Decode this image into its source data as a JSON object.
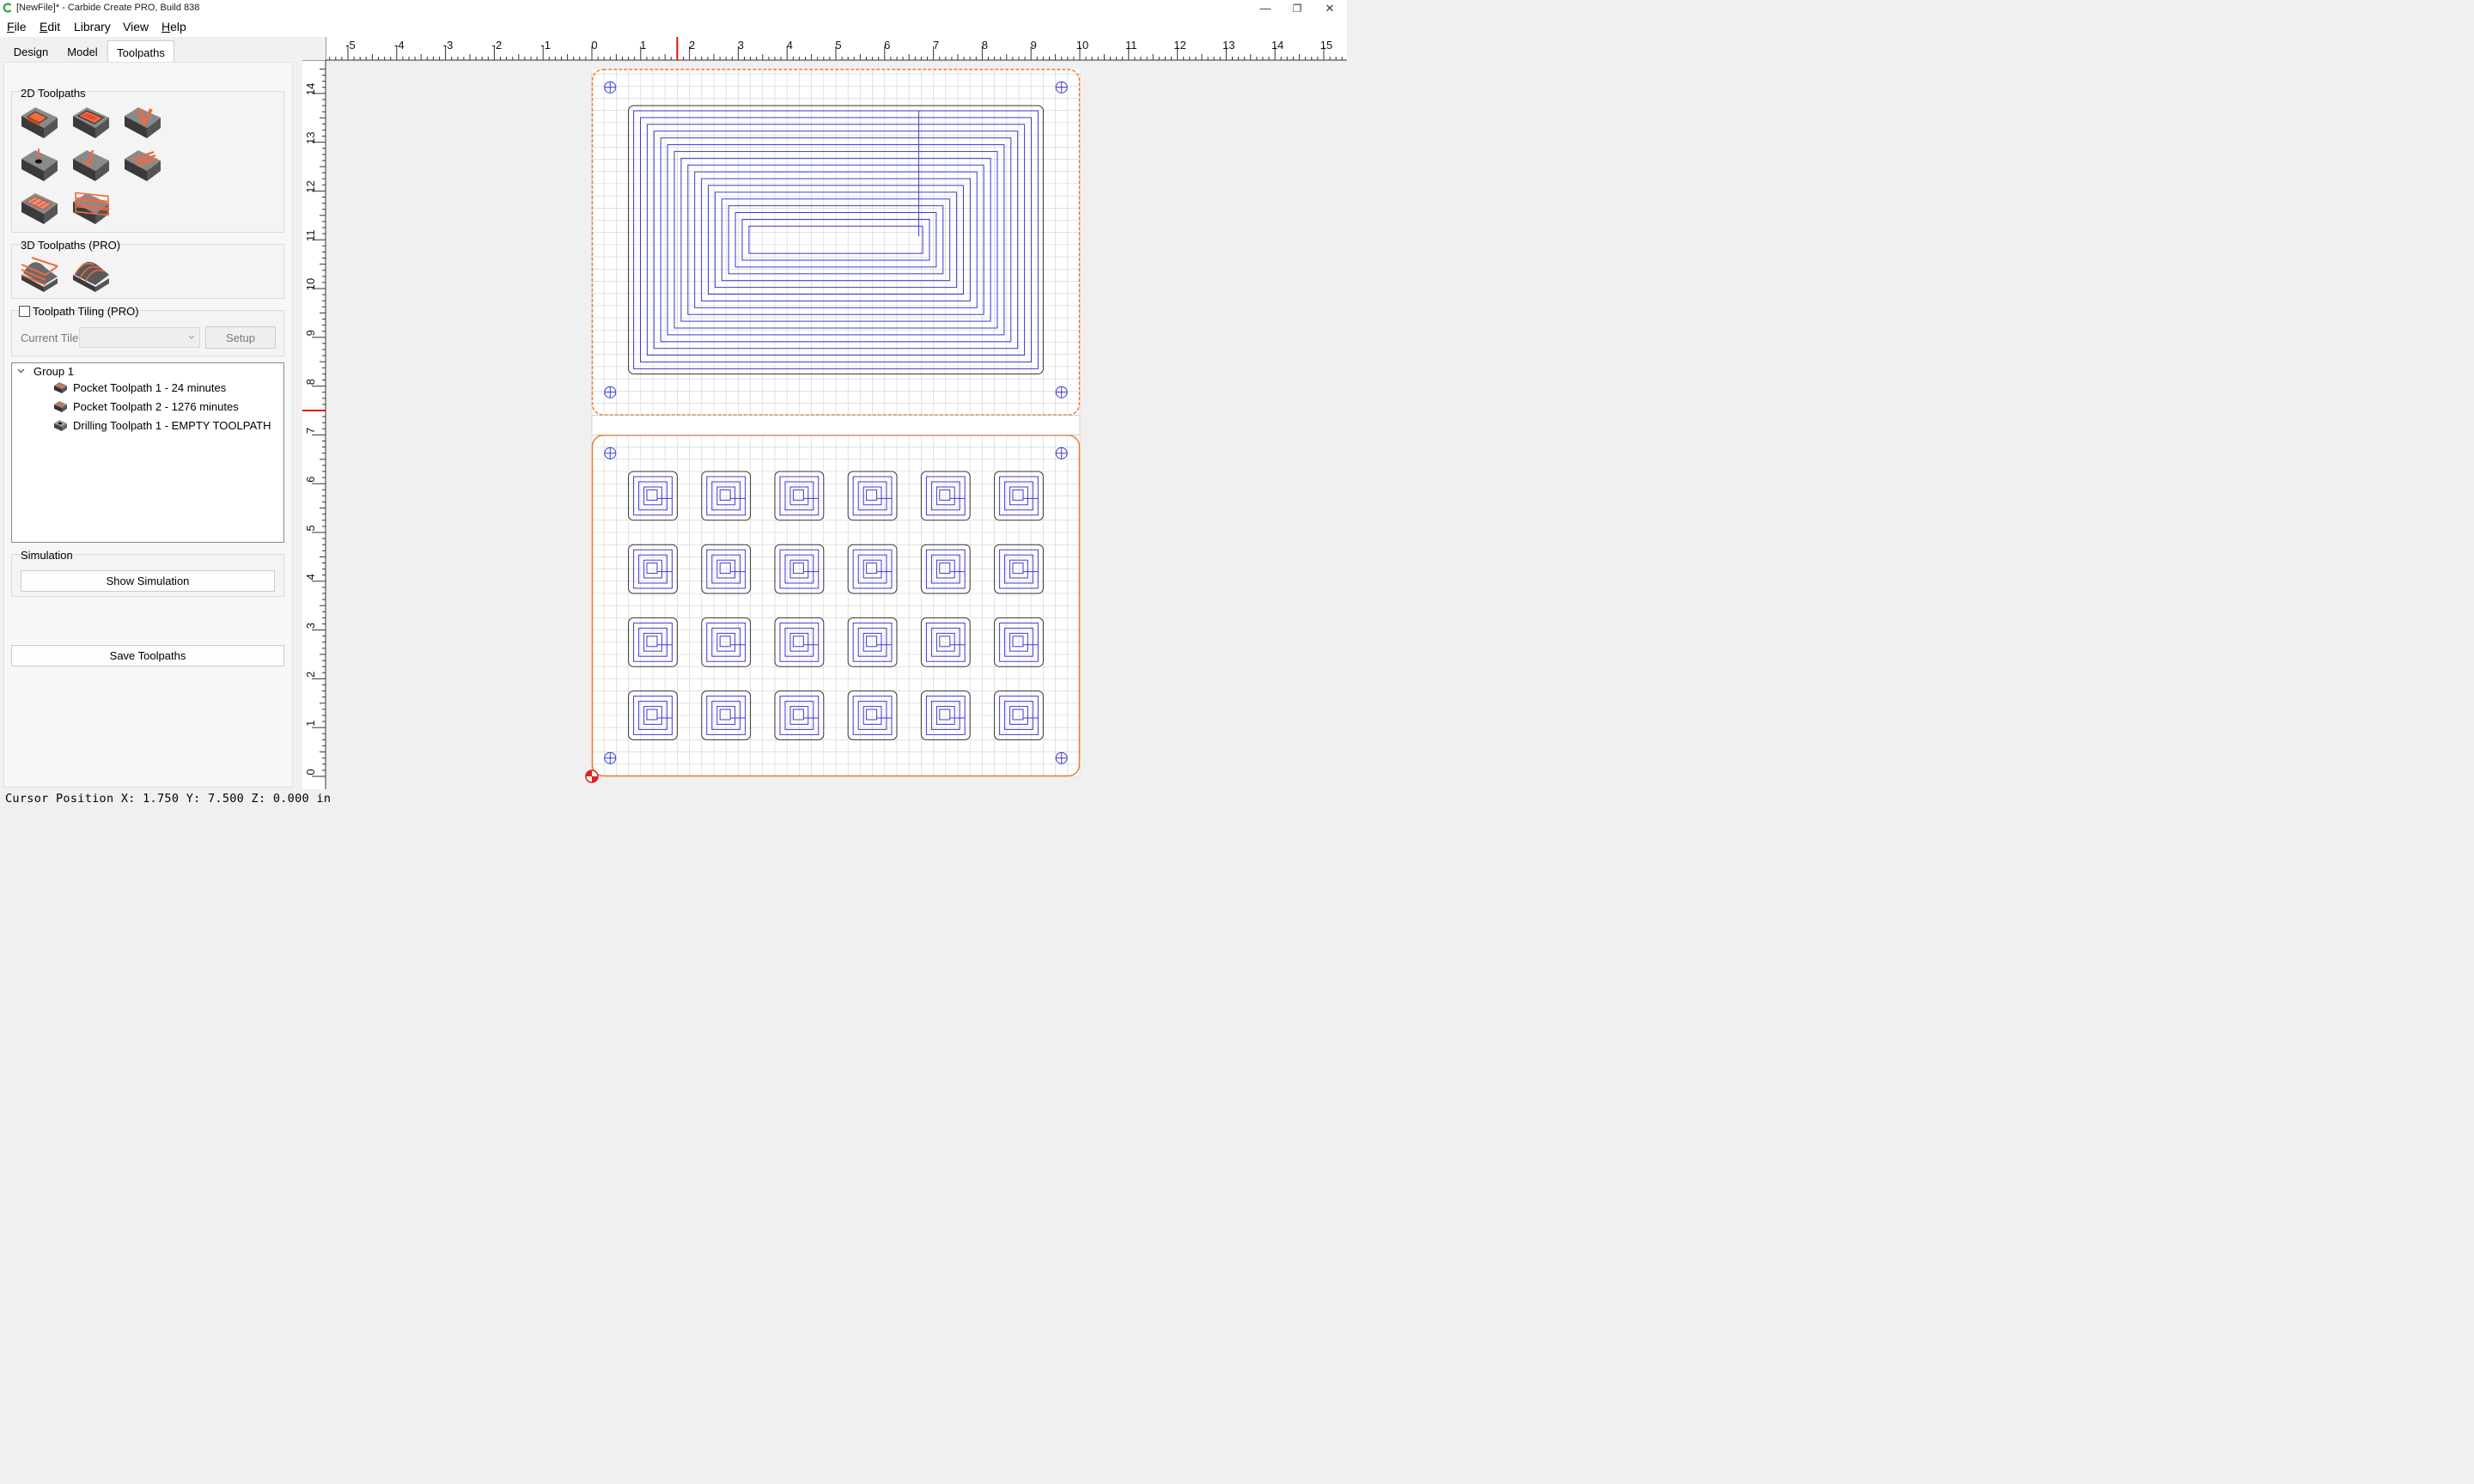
{
  "window": {
    "title": "[NewFile]* - Carbide Create PRO, Build 838",
    "minimize_glyph": "—",
    "restore_glyph": "❐",
    "close_glyph": "✕",
    "accent_color": "#2ea043"
  },
  "menu": {
    "file": {
      "u": "F",
      "rest": "ile"
    },
    "edit": {
      "u": "E",
      "rest": "dit"
    },
    "library": "Library",
    "view": "View",
    "help": {
      "u": "H",
      "rest": "elp"
    }
  },
  "tabs": {
    "design": "Design",
    "model": "Model",
    "toolpaths": "Toolpaths",
    "active": "Toolpaths"
  },
  "panel": {
    "toolpaths_2d_title": "2D Toolpaths",
    "toolpaths_3d_title": "3D Toolpaths (PRO)",
    "tiling_label": "Toolpath Tiling (PRO)",
    "tiling_checked": false,
    "current_tile_label": "Current Tile",
    "current_tile_value": "",
    "setup_label": "Setup",
    "tools_2d": [
      "contour-toolpath-icon",
      "pocket-toolpath-icon",
      "vcarve-toolpath-icon",
      "drilling-toolpath-icon",
      "ball-drill-toolpath-icon",
      "texture-toolpath-icon",
      "advanced-vcarve-icon",
      "rough-pocket-icon"
    ],
    "tools_3d": [
      "3d-rough-toolpath-icon",
      "3d-finish-toolpath-icon"
    ],
    "simulation_title": "Simulation",
    "show_simulation_label": "Show Simulation",
    "save_toolpaths_label": "Save Toolpaths"
  },
  "tree": {
    "group_label": "Group 1",
    "items": [
      {
        "label": "Pocket Toolpath 1 - 24 minutes",
        "icon": "pocket-toolpath-icon"
      },
      {
        "label": "Pocket Toolpath 2 - 1276 minutes",
        "icon": "pocket-toolpath-icon"
      },
      {
        "label": "Drilling Toolpath 1 - EMPTY TOOLPATH",
        "icon": "drilling-toolpath-icon"
      }
    ]
  },
  "canvas": {
    "units": "in",
    "x_ticks": [
      "-5",
      "-4",
      "-3",
      "-2",
      "-1",
      "0",
      "1",
      "2",
      "3",
      "4",
      "5",
      "6",
      "7",
      "8",
      "9",
      "10",
      "11",
      "12",
      "13",
      "14",
      "15"
    ],
    "y_ticks": [
      "0",
      "1",
      "2",
      "3",
      "4",
      "5",
      "6",
      "7",
      "8",
      "9",
      "10",
      "11",
      "12",
      "13",
      "14"
    ],
    "x_range": [
      -5.5,
      15.5
    ],
    "y_range": [
      0,
      14.5
    ],
    "cursor_marker": {
      "x": 1.75,
      "y": 7.5
    },
    "top_stock": {
      "x": [
        0,
        10
      ],
      "y": [
        7.4,
        14.5
      ],
      "corner_radius": 0.375
    },
    "bottom_stock": {
      "x": [
        0,
        10
      ],
      "y": [
        0,
        7
      ],
      "corner_radius": 0.375
    },
    "big_pocket": {
      "x": [
        0.75,
        9.25
      ],
      "y": [
        8.25,
        13.75
      ],
      "rings": 18
    },
    "small_pocket_grid": {
      "columns": 6,
      "rows": 4,
      "x_starts": [
        0.75,
        2.25,
        3.75,
        5.25,
        6.75,
        8.25
      ],
      "y_starts": [
        5.25,
        3.75,
        2.25,
        0.75
      ],
      "size": 1.0
    },
    "hole_marks": [
      [
        0.375,
        14.125
      ],
      [
        9.625,
        14.125
      ],
      [
        0.375,
        7.875
      ],
      [
        9.625,
        7.875
      ],
      [
        0.375,
        6.625
      ],
      [
        9.625,
        6.625
      ],
      [
        0.375,
        0.375
      ],
      [
        9.625,
        0.375
      ]
    ],
    "colors": {
      "stock_outline": "#f07a2a",
      "toolpath": "#3a3ad6",
      "shape": "#333333",
      "grid": "#d0d0d0",
      "cursor": "#e01010",
      "origin": "#e02020"
    }
  },
  "status": {
    "text": "Cursor Position X: 1.750 Y: 7.500 Z: 0.000 in"
  }
}
